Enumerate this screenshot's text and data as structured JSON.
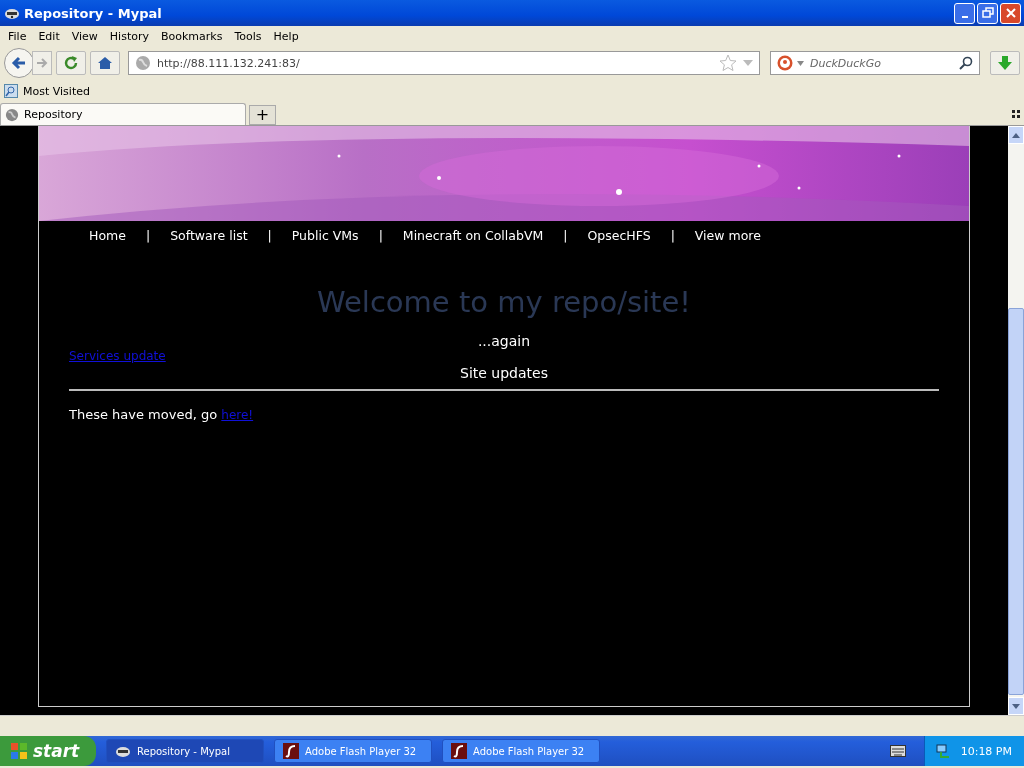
{
  "window": {
    "title": "Repository - Mypal"
  },
  "menu": [
    "File",
    "Edit",
    "View",
    "History",
    "Bookmarks",
    "Tools",
    "Help"
  ],
  "address": {
    "value": "http://88.111.132.241:83/"
  },
  "search": {
    "placeholder": "DuckDuckGo"
  },
  "bookmarks": [
    "Most Visited"
  ],
  "tabs": [
    {
      "label": "Repository",
      "selected": true
    }
  ],
  "new_tab": "+",
  "page": {
    "nav": [
      "Home",
      "Software list",
      "Public VMs",
      "Minecraft on CollabVM",
      "OpsecHFS",
      "View more"
    ],
    "nav_separator": "|",
    "heading": "Welcome to my repo/site!",
    "subheading": "...again",
    "link": "Services update",
    "section_title": "Site updates",
    "moved_text": "These have moved, go ",
    "moved_link": "here!"
  },
  "taskbar": {
    "start": "start",
    "items": [
      {
        "label": "Repository - Mypal",
        "kind": "browser",
        "selected": true
      },
      {
        "label": "Adobe Flash Player 32",
        "kind": "flash",
        "selected": false
      },
      {
        "label": "Adobe Flash Player 32",
        "kind": "flash",
        "selected": false
      }
    ],
    "clock": "10:18 PM"
  }
}
